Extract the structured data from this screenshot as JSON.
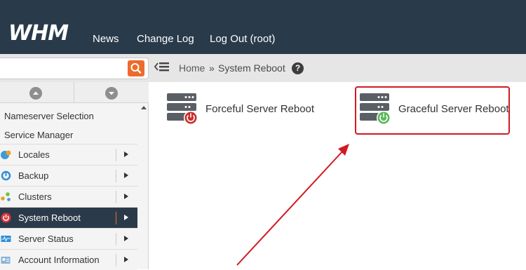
{
  "header": {
    "logo": "WHM",
    "nav": [
      "News",
      "Change Log",
      "Log Out (root)"
    ]
  },
  "breadcrumb": {
    "home": "Home",
    "separator": "»",
    "current": "System Reboot"
  },
  "search": {
    "placeholder": "",
    "value": ""
  },
  "sidebar": {
    "subitems": [
      "Nameserver Selection",
      "Service Manager"
    ],
    "items": [
      {
        "label": "Locales",
        "icon": "globe-chat-icon"
      },
      {
        "label": "Backup",
        "icon": "backup-icon"
      },
      {
        "label": "Clusters",
        "icon": "clusters-icon"
      },
      {
        "label": "System Reboot",
        "icon": "power-icon",
        "active": true
      },
      {
        "label": "Server Status",
        "icon": "monitor-pulse-icon"
      },
      {
        "label": "Account Information",
        "icon": "account-info-icon"
      }
    ]
  },
  "content": {
    "options": [
      {
        "label": "Forceful Server Reboot",
        "icon": "server-power-red-icon"
      },
      {
        "label": "Graceful Server Reboot",
        "icon": "server-power-green-icon"
      }
    ]
  },
  "colors": {
    "header_bg": "#293a4a",
    "accent_orange": "#ee6a2b",
    "highlight_red": "#d11a22",
    "active_item_bg": "#2b3a4a",
    "forceful_red": "#c9302c",
    "graceful_green": "#5cb85c"
  }
}
